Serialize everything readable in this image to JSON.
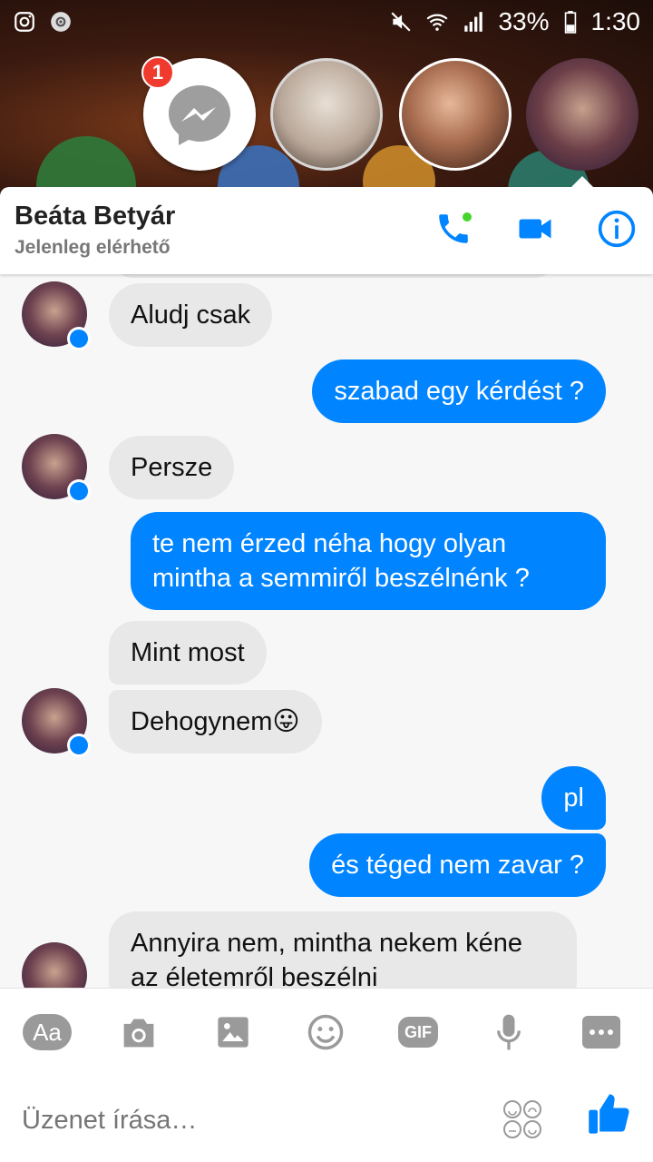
{
  "status_bar": {
    "battery": "33%",
    "time": "1:30"
  },
  "chat_heads": {
    "badge_count": "1"
  },
  "header": {
    "name": "Beáta Betyár",
    "status": "Jelenleg elérhető"
  },
  "messages": [
    {
      "from": "them",
      "text": "Aludj csak"
    },
    {
      "from": "me",
      "text": "szabad egy kérdést ?"
    },
    {
      "from": "them",
      "text": "Persze"
    },
    {
      "from": "me",
      "text": "te nem érzed néha hogy olyan mintha a semmiről beszélnénk ?"
    },
    {
      "from": "them",
      "text": "Mint most"
    },
    {
      "from": "them",
      "text": "Dehogynem😛"
    },
    {
      "from": "me",
      "text": "pl"
    },
    {
      "from": "me",
      "text": "és téged nem zavar ?"
    },
    {
      "from": "them",
      "text": "Annyira nem, mintha nekem kéne az életemről beszélni"
    }
  ],
  "composer": {
    "aa_label": "Aa",
    "gif_label": "GIF",
    "placeholder": "Üzenet írása…"
  },
  "colors": {
    "accent": "#0084ff",
    "incoming_bubble": "#e8e8e8",
    "badge": "#f03a2e"
  },
  "icons": [
    "instagram-icon",
    "disc-icon",
    "mute-icon",
    "wifi-icon",
    "signal-icon",
    "battery-icon",
    "messenger-icon",
    "phone-icon",
    "video-icon",
    "info-icon",
    "camera-icon",
    "image-icon",
    "emoji-icon",
    "mic-icon",
    "more-icon",
    "sticker-icon",
    "like-icon"
  ]
}
